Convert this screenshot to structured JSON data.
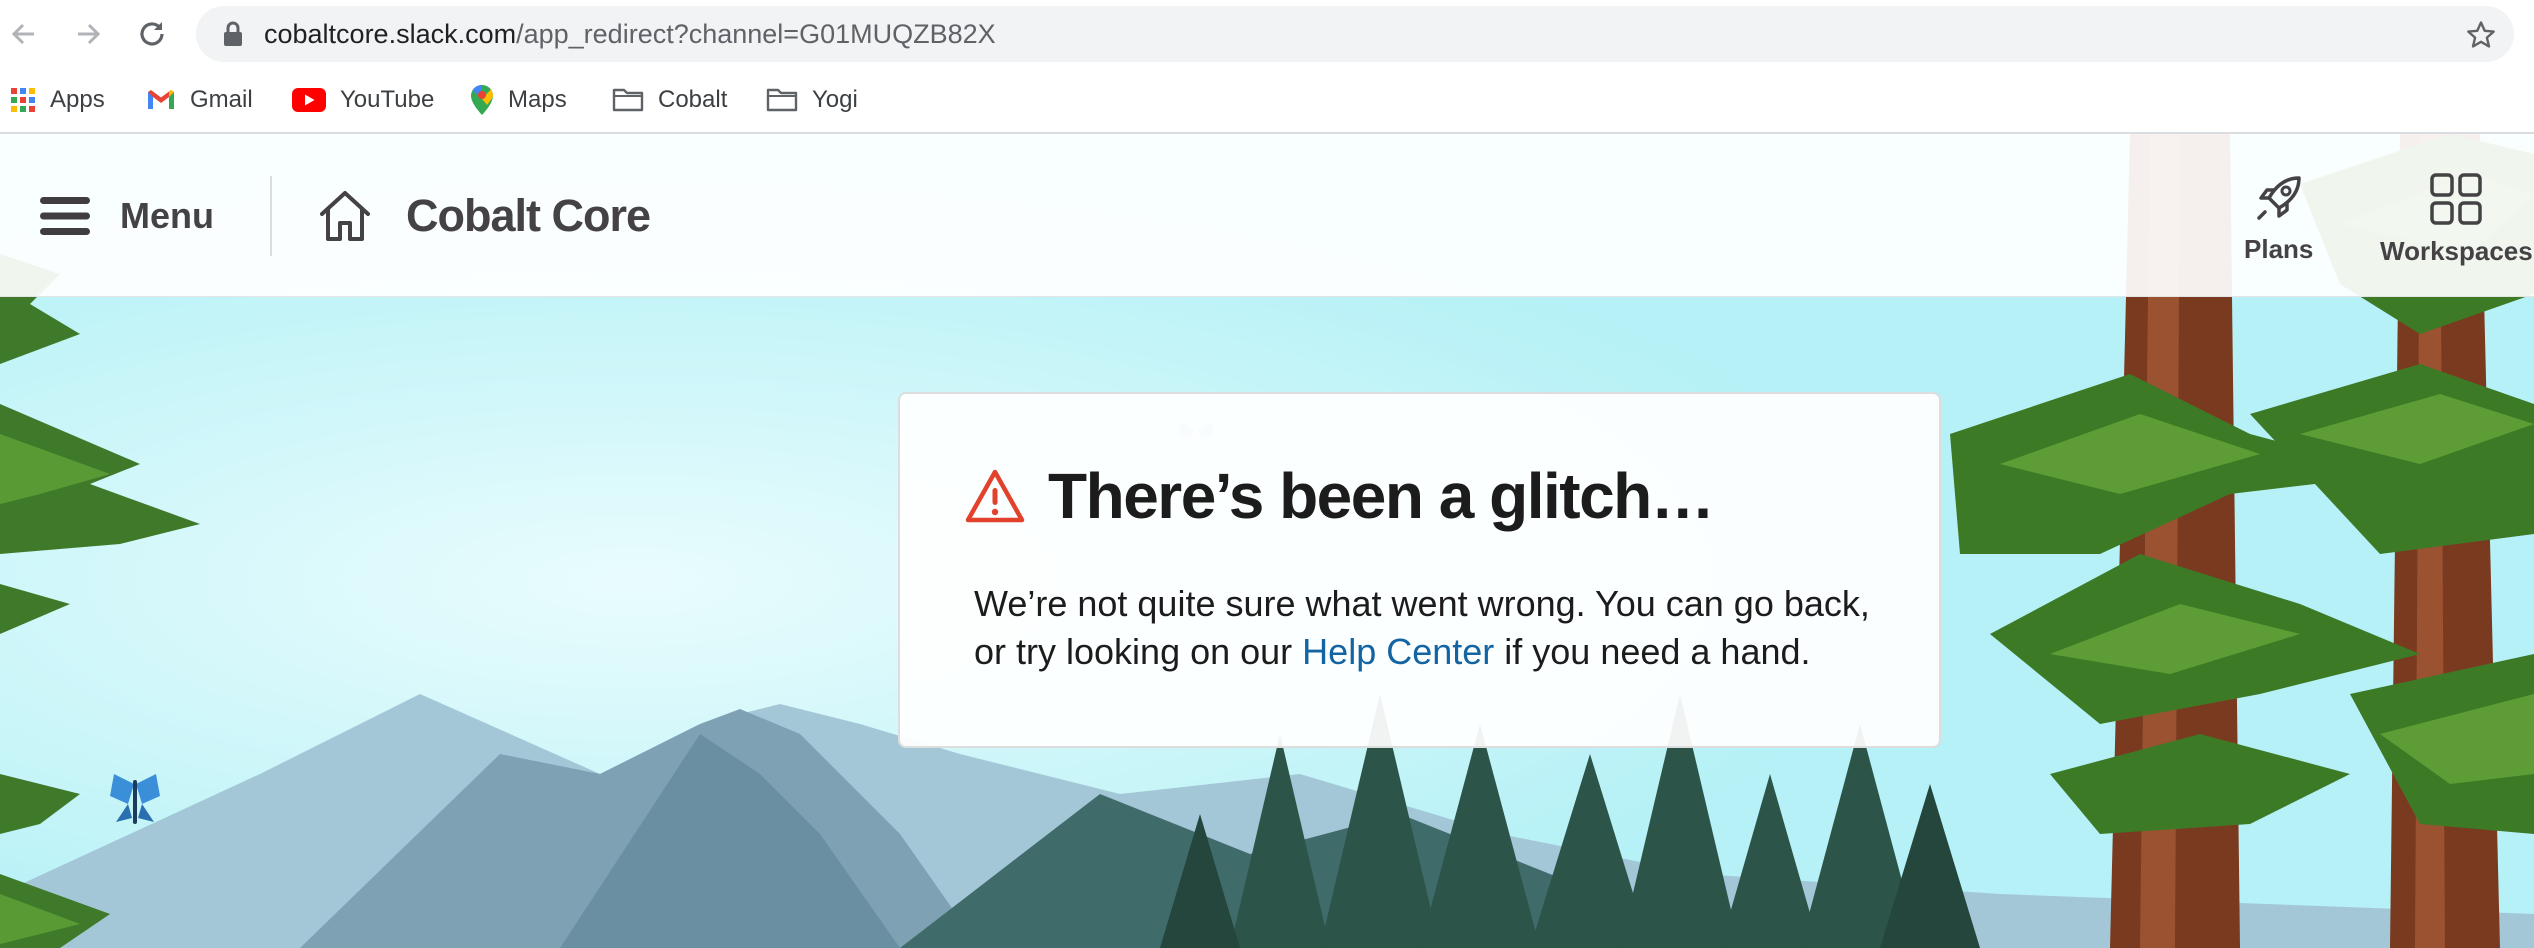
{
  "browser": {
    "url_host": "cobaltcore.slack.com",
    "url_path": "/app_redirect?channel=G01MUQZB82X",
    "bookmarks": [
      {
        "label": "Apps",
        "icon": "apps-grid-icon"
      },
      {
        "label": "Gmail",
        "icon": "gmail-icon"
      },
      {
        "label": "YouTube",
        "icon": "youtube-icon"
      },
      {
        "label": "Maps",
        "icon": "maps-pin-icon"
      },
      {
        "label": "Cobalt",
        "icon": "folder-icon"
      },
      {
        "label": "Yogi",
        "icon": "folder-icon"
      }
    ]
  },
  "header": {
    "menu_label": "Menu",
    "workspace_name": "Cobalt Core",
    "plans_label": "Plans",
    "workspaces_label": "Workspaces"
  },
  "error": {
    "title": "There’s been a glitch…",
    "body_before": "We’re not quite sure what went wrong. You can go back, or try looking on our ",
    "link_text": "Help Center",
    "body_after": " if you need a hand."
  },
  "colors": {
    "sky": "#b5f1f6",
    "warning": "#e01e5a",
    "link": "#1264a3",
    "text": "#1d1c1d"
  }
}
